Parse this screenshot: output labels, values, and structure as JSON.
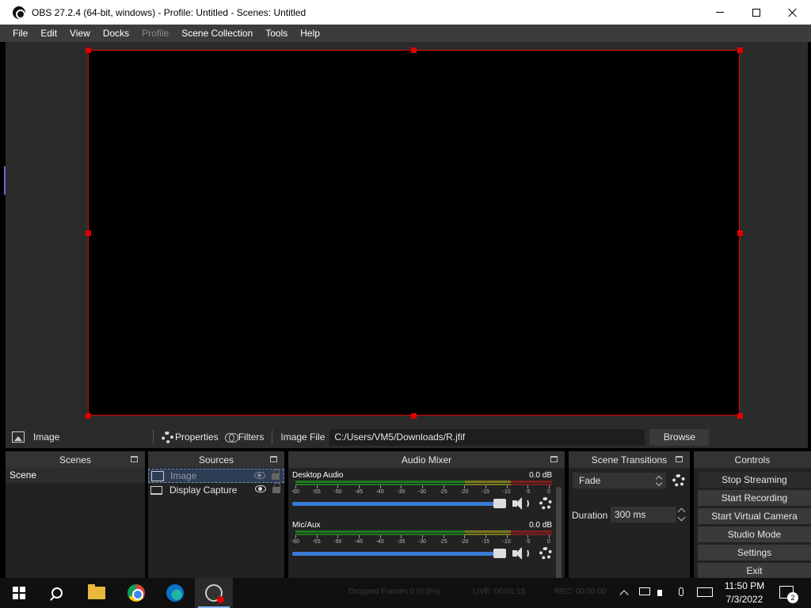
{
  "window": {
    "title": "OBS 27.2.4 (64-bit, windows) - Profile: Untitled - Scenes: Untitled"
  },
  "menu": {
    "items": [
      "File",
      "Edit",
      "View",
      "Docks",
      "Profile",
      "Scene Collection",
      "Tools",
      "Help"
    ]
  },
  "source_toolbar": {
    "source_name": "Image",
    "properties_label": "Properties",
    "filters_label": "Filters",
    "image_file_label": "Image File",
    "image_file_value": "C:/Users/VM5/Downloads/R.jfif",
    "browse_label": "Browse"
  },
  "scenes": {
    "title": "Scenes",
    "items": [
      "Scene"
    ]
  },
  "sources": {
    "title": "Sources",
    "items": [
      "Image",
      "Display Capture"
    ]
  },
  "mixer": {
    "title": "Audio Mixer",
    "channels": [
      {
        "name": "Desktop Audio",
        "db": "0.0 dB"
      },
      {
        "name": "Mic/Aux",
        "db": "0.0 dB"
      }
    ],
    "ticks": [
      "-60",
      "-55",
      "-50",
      "-45",
      "-40",
      "-35",
      "-30",
      "-25",
      "-20",
      "-15",
      "-10",
      "-5",
      "0"
    ]
  },
  "transitions": {
    "title": "Scene Transitions",
    "selected": "Fade",
    "duration_label": "Duration",
    "duration_value": "300 ms"
  },
  "controls": {
    "title": "Controls",
    "buttons": [
      "Stop Streaming",
      "Start Recording",
      "Start Virtual Camera",
      "Studio Mode",
      "Settings",
      "Exit"
    ]
  },
  "statusbar": {
    "dropped_frames": "Dropped Frames 0 (0.0%)",
    "live": "LIVE: 00:01:15",
    "rec": "REC: 00:00:00"
  },
  "taskbar": {
    "time": "11:50 PM",
    "date": "7/3/2022",
    "notification_count": "2"
  },
  "colors": {
    "selection_border": "#e00000",
    "accent": "#3a7bd5"
  }
}
